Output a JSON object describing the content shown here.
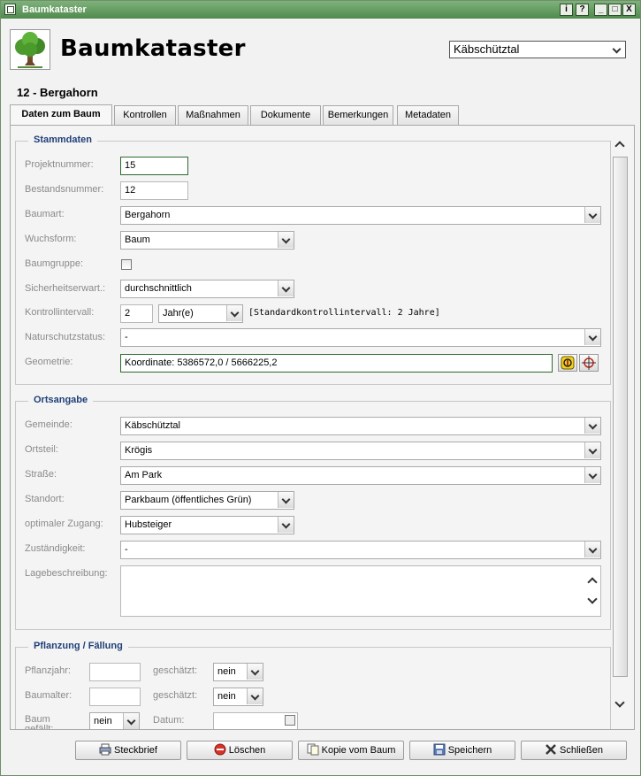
{
  "window": {
    "title": "Baumkataster",
    "buttons": [
      "i",
      "?",
      "_",
      "□",
      "X"
    ]
  },
  "header": {
    "app_title": "Baumkataster",
    "municipality": "Käbschütztal"
  },
  "record": {
    "title": "12 - Bergahorn"
  },
  "tabs": [
    "Daten zum Baum",
    "Kontrollen",
    "Maßnahmen",
    "Dokumente",
    "Bemerkungen",
    "Metadaten"
  ],
  "stammdaten": {
    "legend": "Stammdaten",
    "projektnummer": {
      "label": "Projektnummer:",
      "value": "15"
    },
    "bestandsnummer": {
      "label": "Bestandsnummer:",
      "value": "12"
    },
    "baumart": {
      "label": "Baumart:",
      "value": "Bergahorn"
    },
    "wuchsform": {
      "label": "Wuchsform:",
      "value": "Baum"
    },
    "baumgruppe": {
      "label": "Baumgruppe:",
      "checked": false
    },
    "sicherheitserwart": {
      "label": "Sicherheitserwart.:",
      "value": "durchschnittlich"
    },
    "kontrollintervall": {
      "label": "Kontrollintervall:",
      "value": "2",
      "unit": "Jahr(e)",
      "note": "[Standardkontrollintervall: 2 Jahre]"
    },
    "naturschutzstatus": {
      "label": "Naturschutzstatus:",
      "value": "-"
    },
    "geometrie": {
      "label": "Geometrie:",
      "value": "Koordinate: 5386572,0 / 5666225,2"
    }
  },
  "ortsangabe": {
    "legend": "Ortsangabe",
    "gemeinde": {
      "label": "Gemeinde:",
      "value": "Käbschütztal"
    },
    "ortsteil": {
      "label": "Ortsteil:",
      "value": "Krögis"
    },
    "strasse": {
      "label": "Straße:",
      "value": "Am Park"
    },
    "standort": {
      "label": "Standort:",
      "value": "Parkbaum (öffentliches Grün)"
    },
    "zugang": {
      "label": "optimaler Zugang:",
      "value": "Hubsteiger"
    },
    "zustaendigkeit": {
      "label": "Zuständigkeit:",
      "value": "-"
    },
    "lagebeschreibung": {
      "label": "Lagebeschreibung:",
      "value": ""
    }
  },
  "pflanzung": {
    "legend": "Pflanzung / Fällung",
    "pflanzjahr": {
      "label": "Pflanzjahr:",
      "value": "",
      "geschaetzt_label": "geschätzt:",
      "geschaetzt": "nein"
    },
    "baumalter": {
      "label": "Baumalter:",
      "value": "",
      "geschaetzt_label": "geschätzt:",
      "geschaetzt": "nein"
    },
    "gefaellt": {
      "label": "Baum gefällt:",
      "value": "nein",
      "datum_label": "Datum:",
      "datum": ""
    }
  },
  "footer": {
    "steckbrief": "Steckbrief",
    "loeschen": "Löschen",
    "kopie": "Kopie vom Baum",
    "speichern": "Speichern",
    "schliessen": "Schließen"
  }
}
